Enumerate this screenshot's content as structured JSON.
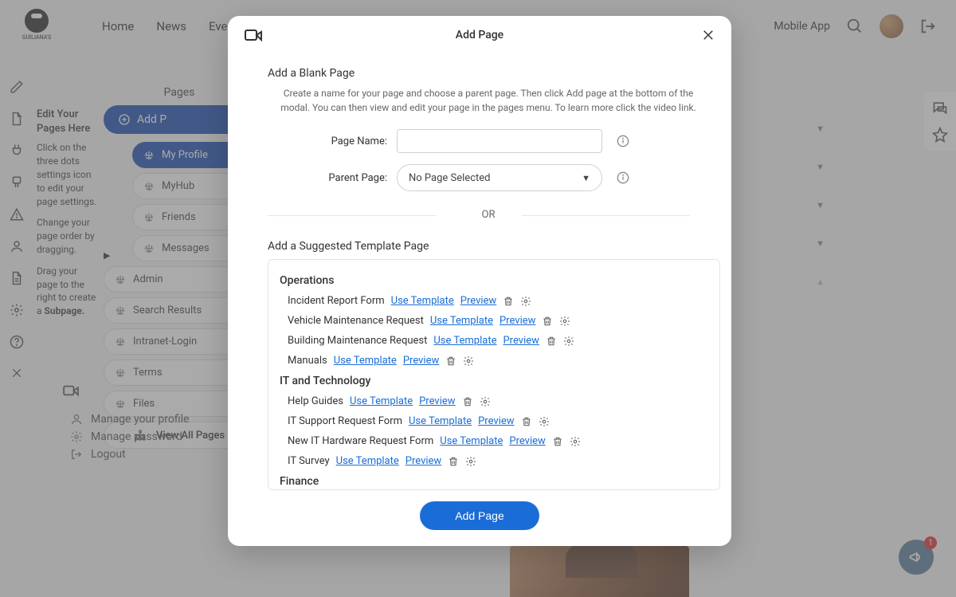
{
  "brand": "GUILIANA'S",
  "nav": {
    "home": "Home",
    "news": "News",
    "events": "Eve",
    "mobile": "Mobile App"
  },
  "helper": {
    "title": "Edit Your Pages Here",
    "p1": "Click on the three dots settings icon to edit your page settings.",
    "p2": "Change your page order by dragging.",
    "p3_a": "Drag your page to the right to create a ",
    "p3_b": "Subpage."
  },
  "pages": {
    "header": "Pages",
    "add": "Add P",
    "items": [
      "My Profile",
      "MyHub",
      "Friends",
      "Messages",
      "Admin",
      "Search Results",
      "Intranet-Login",
      "Terms",
      "Files"
    ],
    "viewall": "View All Pages"
  },
  "profmenu": {
    "profile": "Manage your profile",
    "password": "Manage password",
    "logout": "Logout"
  },
  "announce": {
    "count": "1"
  },
  "modal": {
    "title": "Add Page",
    "blank_title": "Add a Blank Page",
    "help": "Create a name for your page and choose a parent page. Then click Add page at the bottom of the modal. You can then view and edit your page in the pages menu. To learn more click the video link.",
    "page_name_label": "Page Name:",
    "parent_page_label": "Parent Page:",
    "parent_placeholder": "No Page Selected",
    "or": "OR",
    "suggested_title": "Add a Suggested Template Page",
    "use_template": "Use Template",
    "preview": "Preview",
    "add_button": "Add Page",
    "categories": [
      {
        "name": "Operations",
        "templates": [
          "Incident Report Form",
          "Vehicle Maintenance Request",
          "Building Maintenance Request",
          "Manuals"
        ]
      },
      {
        "name": "IT and Technology",
        "templates": [
          "Help Guides",
          "IT Support Request Form",
          "New IT Hardware Request Form",
          "IT Survey"
        ]
      },
      {
        "name": "Finance",
        "templates": []
      }
    ]
  }
}
